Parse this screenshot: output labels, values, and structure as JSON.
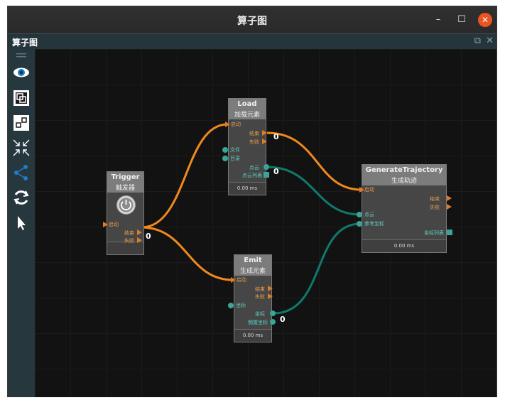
{
  "window": {
    "title": "算子图",
    "minimize": "–",
    "maximize": "☐",
    "close": "✕"
  },
  "panel": {
    "title": "算子图",
    "undock": "⧉",
    "close": "✕"
  },
  "toolbar": {
    "items": [
      "visibility-toggle",
      "fit-view",
      "layout",
      "collapse",
      "connections",
      "refresh",
      "select-pointer"
    ]
  },
  "nodes": {
    "trigger": {
      "title": "Trigger",
      "subtitle": "触发器",
      "in_start": "启动",
      "out_end": "结束",
      "out_fail": "失败",
      "counter": "0"
    },
    "load": {
      "title": "Load",
      "subtitle": "加载元素",
      "in_start": "启动",
      "out_end": "结束",
      "out_fail": "失败",
      "in_file": "文件",
      "in_dir": "目录",
      "out_cloud": "点云",
      "out_cloud_list": "点云列表",
      "time": "0.00 ms",
      "counter_end": "0",
      "counter_cloud": "0"
    },
    "emit": {
      "title": "Emit",
      "subtitle": "生成元素",
      "in_start": "启动",
      "out_end": "结束",
      "out_fail": "失败",
      "in_coord": "坐标",
      "out_coord": "坐标",
      "out_coord_inverse": "倒置坐标",
      "time": "0.00 ms",
      "counter": "0"
    },
    "generate": {
      "title": "GenerateTrajectory",
      "subtitle": "生成轨迹",
      "in_start": "启动",
      "out_end": "结束",
      "out_fail": "失败",
      "in_cloud": "点云",
      "in_ref": "参考坐标",
      "out_coord_list": "坐标列表",
      "time": "0.00 ms"
    }
  },
  "colors": {
    "control_wire": "#f08a1c",
    "data_wire": "#0f7a6b",
    "close_button": "#e95420"
  }
}
